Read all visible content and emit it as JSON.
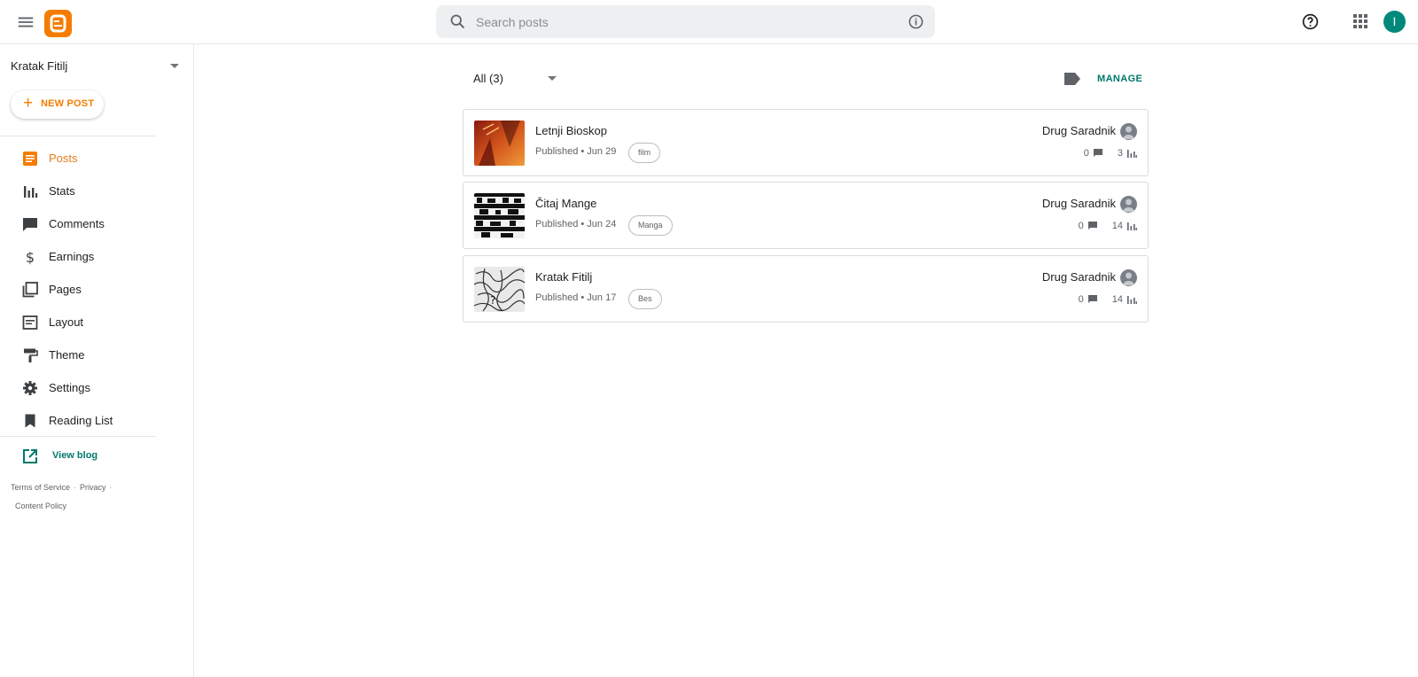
{
  "topbar": {
    "search_placeholder": "Search posts",
    "account_initial": "I"
  },
  "sidebar": {
    "blog_name": "Kratak Fitilj",
    "new_post_label": "NEW POST",
    "nav": [
      {
        "label": "Posts",
        "icon": "posts-icon",
        "active": true
      },
      {
        "label": "Stats",
        "icon": "stats-icon"
      },
      {
        "label": "Comments",
        "icon": "comments-icon"
      },
      {
        "label": "Earnings",
        "icon": "dollar-icon"
      },
      {
        "label": "Pages",
        "icon": "pages-icon"
      },
      {
        "label": "Layout",
        "icon": "layout-icon"
      },
      {
        "label": "Theme",
        "icon": "paint-roller-icon"
      },
      {
        "label": "Settings",
        "icon": "gear-icon"
      },
      {
        "label": "Reading List",
        "icon": "bookmark-icon"
      }
    ],
    "view_blog_label": "View blog",
    "footer": {
      "terms": "Terms of Service",
      "privacy": "Privacy",
      "content_policy": "Content Policy"
    }
  },
  "main": {
    "filter_label": "All (3)",
    "manage_label": "MANAGE",
    "posts": [
      {
        "title": "Letnji Bioskop",
        "status": "Published",
        "date": "Jun 29",
        "tag": "film",
        "author": "Drug Saradnik",
        "comments": "0",
        "views": "3"
      },
      {
        "title": "Čitaj Mange",
        "status": "Published",
        "date": "Jun 24",
        "tag": "Manga",
        "author": "Drug Saradnik",
        "comments": "0",
        "views": "14"
      },
      {
        "title": "Kratak Fitilj",
        "status": "Published",
        "date": "Jun 17",
        "tag": "Bes",
        "author": "Drug Saradnik",
        "comments": "0",
        "views": "14"
      }
    ]
  },
  "colors": {
    "accent_orange": "#f57c00",
    "active_nav_text": "#e67c1b",
    "teal_link": "#00796b",
    "avatar_bg": "#00897b"
  }
}
